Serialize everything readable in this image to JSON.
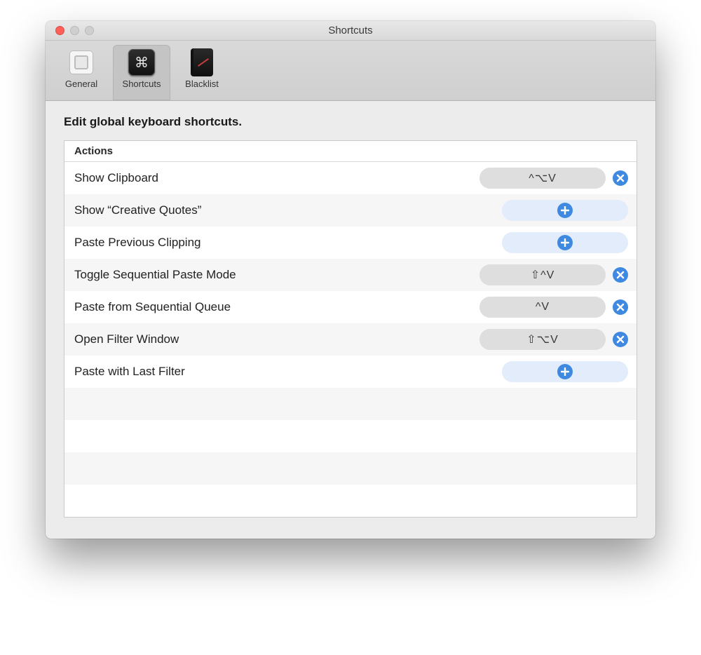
{
  "window": {
    "title": "Shortcuts"
  },
  "tabs": {
    "general": "General",
    "shortcuts": "Shortcuts",
    "blacklist": "Blacklist"
  },
  "heading": "Edit global keyboard shortcuts.",
  "table": {
    "header": "Actions",
    "rows": [
      {
        "label": "Show Clipboard",
        "shortcut": "^⌥V",
        "assigned": true
      },
      {
        "label": "Show “Creative Quotes”",
        "shortcut": "",
        "assigned": false
      },
      {
        "label": "Paste Previous Clipping",
        "shortcut": "",
        "assigned": false
      },
      {
        "label": "Toggle Sequential Paste Mode",
        "shortcut": "⇧^V",
        "assigned": true
      },
      {
        "label": "Paste from Sequential Queue",
        "shortcut": "^V",
        "assigned": true
      },
      {
        "label": "Open Filter Window",
        "shortcut": "⇧⌥V",
        "assigned": true
      },
      {
        "label": "Paste with Last Filter",
        "shortcut": "",
        "assigned": false
      }
    ],
    "empty_rows": 4
  },
  "icons": {
    "cmd_glyph": "⌘"
  },
  "colors": {
    "accent": "#3f8ae0"
  }
}
